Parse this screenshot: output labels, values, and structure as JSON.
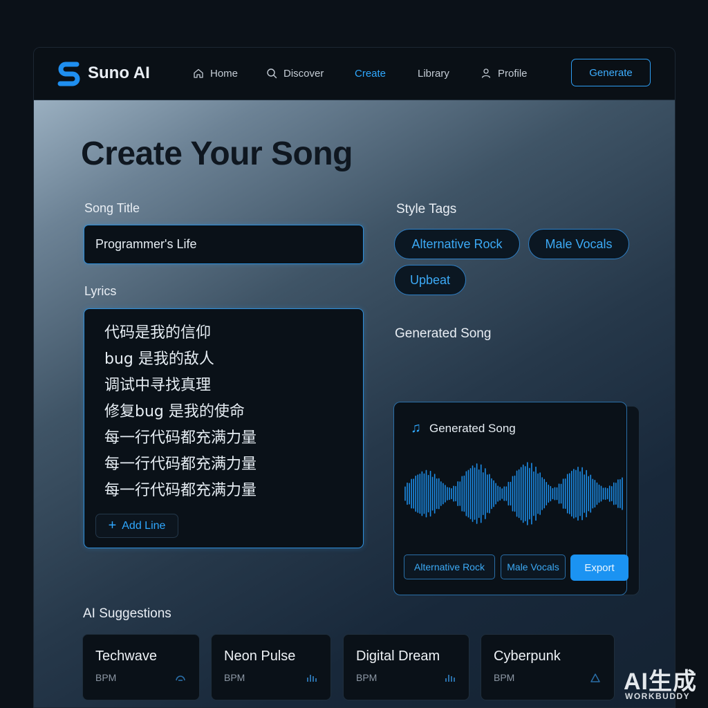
{
  "brand": {
    "name": "Suno AI"
  },
  "nav": [
    {
      "label": "Home",
      "icon": "home-icon"
    },
    {
      "label": "Discover",
      "icon": "search-icon"
    },
    {
      "label": "Create",
      "icon": null,
      "active": true
    },
    {
      "label": "Library",
      "icon": null
    },
    {
      "label": "Profile",
      "icon": "user-icon"
    }
  ],
  "header": {
    "generate_label": "Generate"
  },
  "page": {
    "title": "Create Your Song"
  },
  "form": {
    "song_title_label": "Song Title",
    "song_title_value": "Programmer's Life",
    "lyrics_label": "Lyrics",
    "lyrics": [
      "代码是我的信仰",
      "bug 是我的敌人",
      "调试中寻找真理",
      "修复bug 是我的使命",
      "每一行代码都充满力量",
      "每一行代码都充满力量",
      "每一行代码都充满力量"
    ],
    "add_line_label": "Add Line"
  },
  "style": {
    "label": "Style Tags",
    "tags": [
      "Alternative Rock",
      "Male Vocals",
      "Upbeat"
    ]
  },
  "generated": {
    "section_label": "Generated Song",
    "card_title": "Generated Song",
    "chips": [
      "Alternative Rock",
      "Male Vocals"
    ],
    "export_label": "Export"
  },
  "suggestions": {
    "label": "AI Suggestions",
    "items": [
      {
        "name": "Techwave",
        "meta": "BPM",
        "icon": "waveform-icon"
      },
      {
        "name": "Neon Pulse",
        "meta": "BPM",
        "icon": "bars-icon"
      },
      {
        "name": "Digital Dream",
        "meta": "BPM",
        "icon": "bars-icon"
      },
      {
        "name": "Cyberpunk",
        "meta": "BPM",
        "icon": "triangle-icon"
      }
    ]
  },
  "watermark": {
    "big": "AI生成",
    "small": "WORKBUDDY"
  },
  "colors": {
    "accent": "#2fa8ff",
    "background": "#0b1118",
    "card": "#0a1118"
  }
}
